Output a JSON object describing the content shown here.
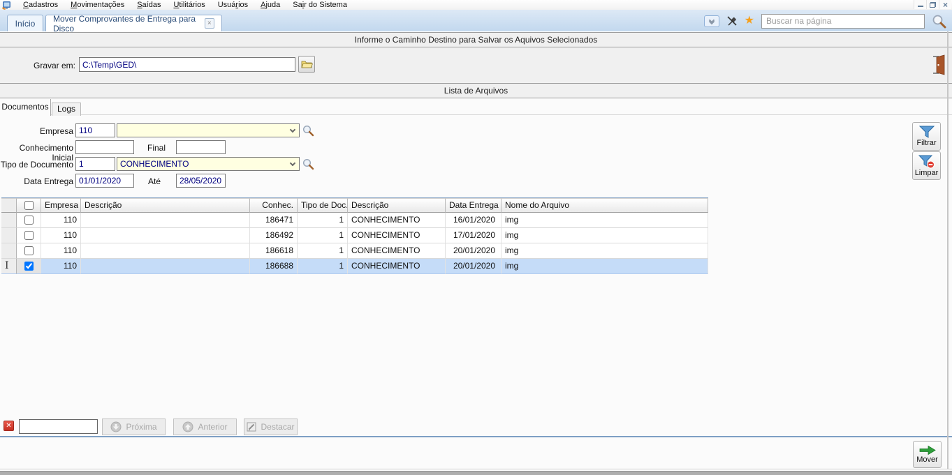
{
  "window": {
    "minimize_glyph": "",
    "close_glyph": "×"
  },
  "menubar": {
    "items": [
      {
        "pre": "",
        "key": "C",
        "post": "adastros"
      },
      {
        "pre": "",
        "key": "M",
        "post": "ovimentações"
      },
      {
        "pre": "",
        "key": "S",
        "post": "aídas"
      },
      {
        "pre": "",
        "key": "U",
        "post": "tilitários"
      },
      {
        "pre": "Usuá",
        "key": "r",
        "post": "ios"
      },
      {
        "pre": "",
        "key": "A",
        "post": "juda"
      },
      {
        "pre": "Sa",
        "key": "i",
        "post": "r do Sistema"
      }
    ]
  },
  "tabbar": {
    "tabs": [
      {
        "label": "Início"
      },
      {
        "label": "Mover Comprovantes de Entrega para Disco",
        "close": "×"
      }
    ],
    "search_placeholder": "Buscar na página"
  },
  "path_section": {
    "header": "Informe o Caminho Destino para Salvar os Aquivos Selecionados",
    "gravar_label": "Gravar em:",
    "gravar_value": "C:\\Temp\\GED\\"
  },
  "list_section": {
    "header": "Lista de Arquivos",
    "tabs": [
      {
        "label": "Documentos"
      },
      {
        "label": "Logs"
      }
    ]
  },
  "filters": {
    "empresa_label": "Empresa",
    "empresa_code": "110",
    "empresa_name": "",
    "conhecimento_label": "Conhecimento Inicial",
    "conhecimento_inicial": "",
    "final_label": "Final",
    "conhecimento_final": "",
    "tipo_label": "Tipo de Documento",
    "tipo_code": "1",
    "tipo_name": "CONHECIMENTO",
    "data_label": "Data Entrega",
    "data_inicial": "01/01/2020",
    "ate_label": "Até",
    "data_final": "28/05/2020",
    "filtrar_label": "Filtrar",
    "limpar_label": "Limpar"
  },
  "grid": {
    "columns": {
      "empresa": "Empresa",
      "descricao": "Descrição",
      "conhec": "Conhec.",
      "tipo": "Tipo de Doc.",
      "descricao2": "Descrição",
      "data": "Data Entrega",
      "arquivo": "Nome do Arquivo"
    },
    "rows": [
      {
        "empresa": "110",
        "descricao": "",
        "conhec": "186471",
        "tipo": "1",
        "tipo_desc": "CONHECIMENTO",
        "data": "16/01/2020",
        "arquivo": "img"
      },
      {
        "empresa": "110",
        "descricao": "",
        "conhec": "186492",
        "tipo": "1",
        "tipo_desc": "CONHECIMENTO",
        "data": "17/01/2020",
        "arquivo": "img"
      },
      {
        "empresa": "110",
        "descricao": "",
        "conhec": "186618",
        "tipo": "1",
        "tipo_desc": "CONHECIMENTO",
        "data": "20/01/2020",
        "arquivo": "img"
      },
      {
        "empresa": "110",
        "descricao": "",
        "conhec": "186688",
        "tipo": "1",
        "tipo_desc": "CONHECIMENTO",
        "data": "20/01/2020",
        "arquivo": "img",
        "checked_attr": "checked"
      }
    ]
  },
  "findbar": {
    "input_value": "",
    "proxima_label": "Próxima",
    "anterior_label": "Anterior",
    "destacar_label": "Destacar"
  },
  "footer": {
    "mover_label": "Mover"
  },
  "colors": {
    "tabbar_blue": "#c9dcf0",
    "selection_blue": "#c5dcf8",
    "combo_yellow": "#ffffe1",
    "value_navy": "#000080",
    "star_orange": "#f6a01c",
    "funnel_blue": "#5b9bd5",
    "mover_green": "#2e9e3a",
    "close_red": "#c62f22"
  }
}
